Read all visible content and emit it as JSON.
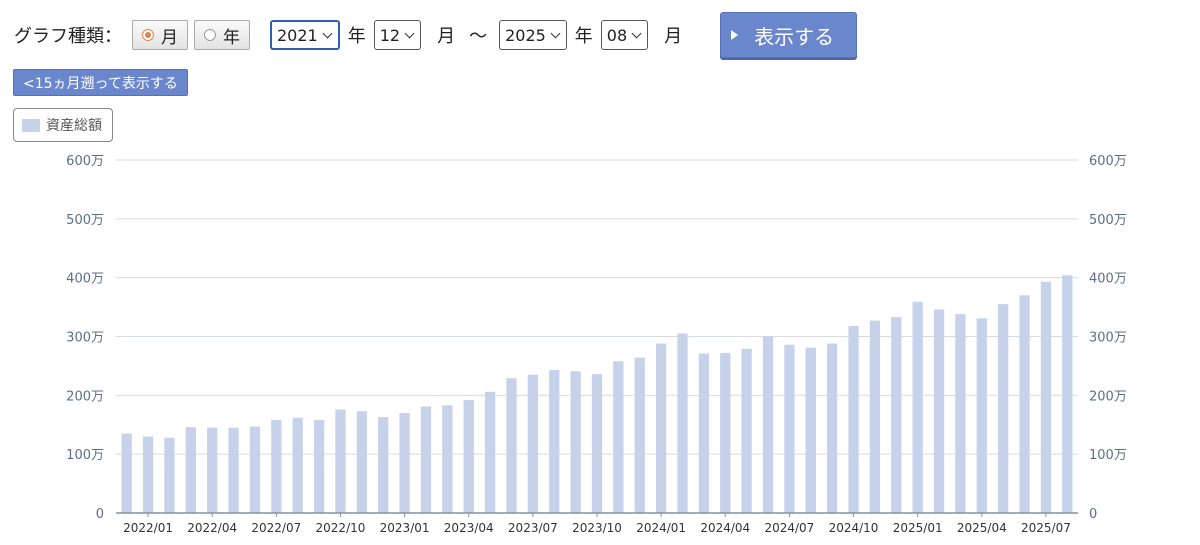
{
  "controls": {
    "graph_type_label": "グラフ種類：",
    "radio_month": "月",
    "radio_year": "年",
    "start_year": "2021",
    "start_month": "12",
    "end_year": "2025",
    "end_month": "08",
    "unit_year": "年",
    "unit_month": "月",
    "tilde": "〜",
    "show_button": "表示する",
    "back_button": "<15ヵ月遡って表示する"
  },
  "colors": {
    "bar": "#c5d2ea",
    "button": "#6a86cc",
    "grid": "#d6dbe3"
  },
  "chart_data": {
    "type": "bar",
    "categories": [
      "2021/12",
      "2022/01",
      "2022/02",
      "2022/03",
      "2022/04",
      "2022/05",
      "2022/06",
      "2022/07",
      "2022/08",
      "2022/09",
      "2022/10",
      "2022/11",
      "2022/12",
      "2023/01",
      "2023/02",
      "2023/03",
      "2023/04",
      "2023/05",
      "2023/06",
      "2023/07",
      "2023/08",
      "2023/09",
      "2023/10",
      "2023/11",
      "2023/12",
      "2024/01",
      "2024/02",
      "2024/03",
      "2024/04",
      "2024/05",
      "2024/06",
      "2024/07",
      "2024/08",
      "2024/09",
      "2024/10",
      "2024/11",
      "2024/12",
      "2025/01",
      "2025/02",
      "2025/03",
      "2025/04",
      "2025/05",
      "2025/06",
      "2025/07",
      "2025/08"
    ],
    "x_tick_labels": [
      "2022/01",
      "2022/04",
      "2022/07",
      "2022/10",
      "2023/01",
      "2023/04",
      "2023/07",
      "2023/10",
      "2024/01",
      "2024/04",
      "2024/07",
      "2024/10",
      "2025/01",
      "2025/04",
      "2025/07"
    ],
    "x_tick_indices": [
      1,
      4,
      7,
      10,
      13,
      16,
      19,
      22,
      25,
      28,
      31,
      34,
      37,
      40,
      43
    ],
    "series": [
      {
        "name": "資産総額",
        "values": [
          135,
          130,
          128,
          146,
          145,
          145,
          147,
          158,
          162,
          158,
          176,
          173,
          163,
          170,
          181,
          183,
          192,
          206,
          229,
          235,
          243,
          241,
          236,
          258,
          264,
          288,
          305,
          271,
          272,
          279,
          300,
          286,
          281,
          288,
          318,
          327,
          333,
          359,
          346,
          338,
          331,
          355,
          370,
          393,
          404
        ]
      }
    ],
    "y_ticks": [
      0,
      100,
      200,
      300,
      400,
      500,
      600
    ],
    "y_tick_labels": [
      "0",
      "100万",
      "200万",
      "300万",
      "400万",
      "500万",
      "600万"
    ],
    "ylim": [
      0,
      600
    ],
    "grid": true,
    "legend": "top-left"
  }
}
